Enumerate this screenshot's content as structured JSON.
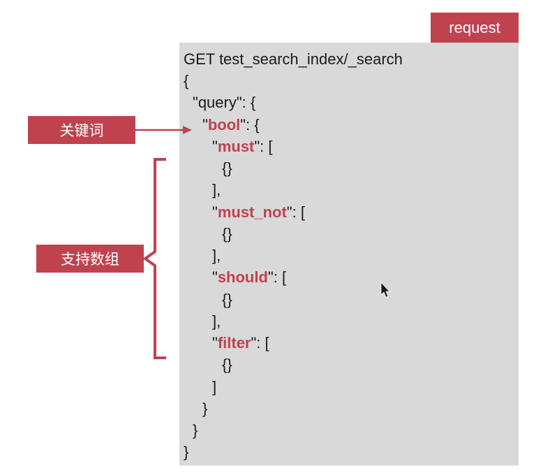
{
  "request_tag": "request",
  "labels": {
    "keyword": "关键词",
    "supports_array": "支持数组"
  },
  "code": {
    "endpoint": "GET test_search_index/_search",
    "open_root": "{",
    "query_key": "query",
    "bool_key": "bool",
    "must_key": "must",
    "must_not_key": "must_not",
    "should_key": "should",
    "filter_key": "filter",
    "empty_obj": "{}",
    "close_arr_comma": "],",
    "close_arr": "]",
    "close_brace": "}"
  },
  "colors": {
    "accent": "#c0424f",
    "panel": "#d9d9d9",
    "text": "#1a1a1a"
  }
}
